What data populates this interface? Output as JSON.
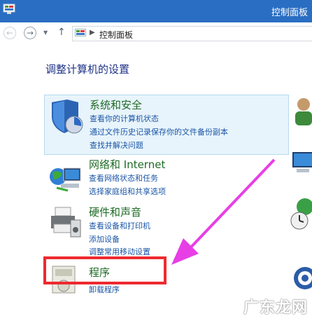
{
  "window": {
    "title": "控制面板"
  },
  "address_bar": {
    "path": "控制面板"
  },
  "heading": "调整计算机的设置",
  "categories": [
    {
      "title": "系统和安全",
      "links": [
        "查看你的计算机状态",
        "通过文件历史记录保存你的文件备份副本",
        "查找并解决问题"
      ]
    },
    {
      "title": "网络和 Internet",
      "links": [
        "查看网络状态和任务",
        "选择家庭组和共享选项"
      ]
    },
    {
      "title": "硬件和声音",
      "links": [
        "查看设备和打印机",
        "添加设备",
        "调整常用移动设置"
      ]
    },
    {
      "title": "程序",
      "links": [
        "卸载程序"
      ]
    }
  ],
  "watermark": "广东龙网",
  "colors": {
    "titlebar": "#2a6ec3",
    "highlight": "#ee2a2f",
    "arrow": "#e83ee6",
    "link": "#1a56a6",
    "category_title": "#1e6b25"
  },
  "icons": [
    "control-panel-icon",
    "back-icon",
    "forward-icon",
    "dropdown-icon",
    "up-icon",
    "shield-icon",
    "network-icon",
    "printer-icon",
    "programs-icon"
  ]
}
